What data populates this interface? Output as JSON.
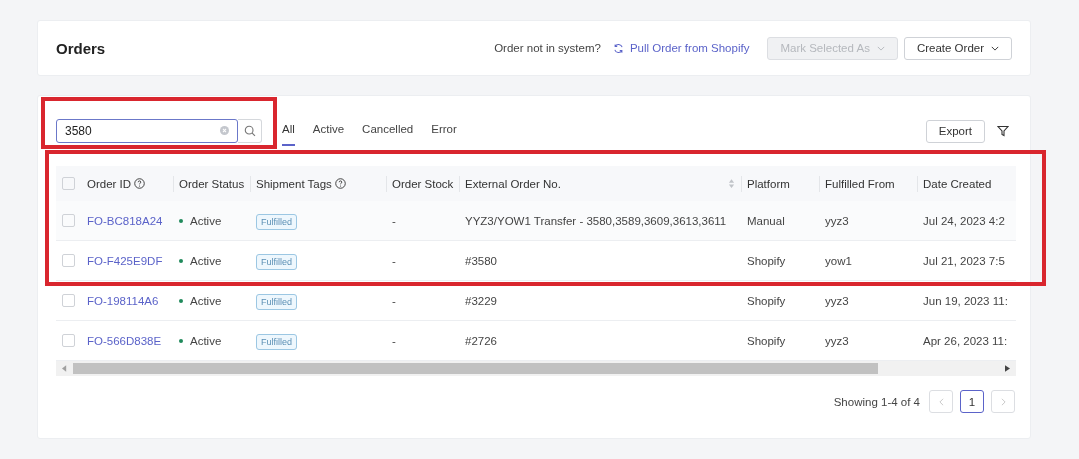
{
  "header": {
    "title": "Orders",
    "prompt": "Order not in system?",
    "pull_link": "Pull Order from Shopify",
    "mark_button": {
      "label": "Mark Selected As",
      "disabled": true
    },
    "create_button": "Create Order"
  },
  "search": {
    "value": "3580"
  },
  "tabs": [
    {
      "label": "All",
      "selected": true
    },
    {
      "label": "Active",
      "selected": false
    },
    {
      "label": "Cancelled",
      "selected": false
    },
    {
      "label": "Error",
      "selected": false
    }
  ],
  "export_button": "Export",
  "table": {
    "select_all": false,
    "columns": [
      {
        "label": "Order ID",
        "help": true,
        "sortable": false
      },
      {
        "label": "Order Status",
        "help": false,
        "sortable": false
      },
      {
        "label": "Shipment Tags",
        "help": true,
        "sortable": false
      },
      {
        "label": "Order Stock",
        "help": false,
        "sortable": false
      },
      {
        "label": "External Order No.",
        "help": false,
        "sortable": true
      },
      {
        "label": "Platform",
        "help": false,
        "sortable": false
      },
      {
        "label": "Fulfilled From",
        "help": false,
        "sortable": false
      },
      {
        "label": "Date Created",
        "help": false,
        "sortable": false
      }
    ],
    "rows": [
      {
        "checked": false,
        "order_id": "FO-BC818A24",
        "status": "Active",
        "tag": "Fulfilled",
        "stock": "-",
        "external": "YYZ3/YOW1 Transfer - 3580,3589,3609,3613,3611",
        "platform": "Manual",
        "fulfilled_from": "yyz3",
        "date": "Jul 24, 2023 4:2"
      },
      {
        "checked": false,
        "order_id": "FO-F425E9DF",
        "status": "Active",
        "tag": "Fulfilled",
        "stock": "-",
        "external": "#3580",
        "platform": "Shopify",
        "fulfilled_from": "yow1",
        "date": "Jul 21, 2023 7:5"
      },
      {
        "checked": false,
        "order_id": "FO-198114A6",
        "status": "Active",
        "tag": "Fulfilled",
        "stock": "-",
        "external": "#3229",
        "platform": "Shopify",
        "fulfilled_from": "yyz3",
        "date": "Jun 19, 2023 11:"
      },
      {
        "checked": false,
        "order_id": "FO-566D838E",
        "status": "Active",
        "tag": "Fulfilled",
        "stock": "-",
        "external": "#2726",
        "platform": "Shopify",
        "fulfilled_from": "yyz3",
        "date": "Apr 26, 2023 11:"
      }
    ]
  },
  "pagination": {
    "summary": "Showing 1-4 of 4",
    "pages": [
      {
        "label": "1",
        "selected": true
      }
    ]
  },
  "highlights": [
    {
      "color": "#d9262e"
    },
    {
      "color": "#d9262e"
    }
  ]
}
